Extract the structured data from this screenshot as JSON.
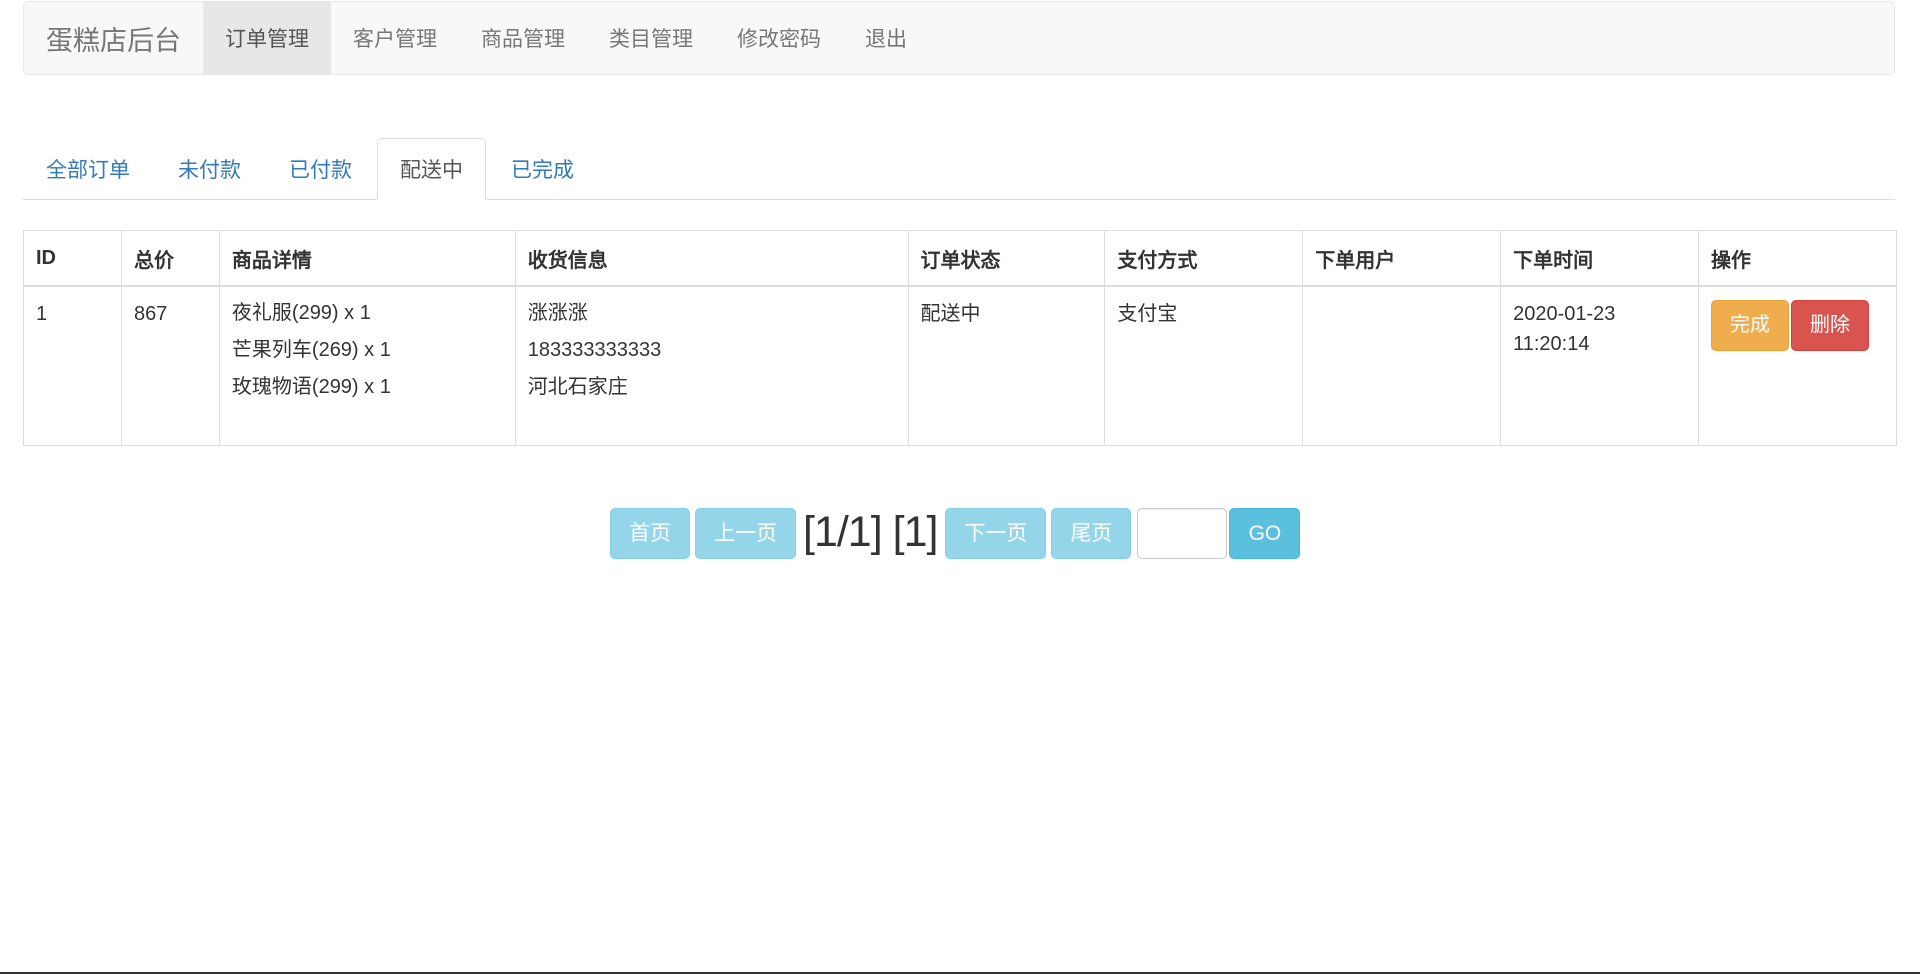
{
  "navbar": {
    "brand": "蛋糕店后台",
    "items": [
      {
        "label": "订单管理",
        "active": true
      },
      {
        "label": "客户管理",
        "active": false
      },
      {
        "label": "商品管理",
        "active": false
      },
      {
        "label": "类目管理",
        "active": false
      },
      {
        "label": "修改密码",
        "active": false
      },
      {
        "label": "退出",
        "active": false
      }
    ]
  },
  "tabs": [
    {
      "label": "全部订单",
      "active": false
    },
    {
      "label": "未付款",
      "active": false
    },
    {
      "label": "已付款",
      "active": false
    },
    {
      "label": "配送中",
      "active": true
    },
    {
      "label": "已完成",
      "active": false
    }
  ],
  "table": {
    "headers": [
      "ID",
      "总价",
      "商品详情",
      "收货信息",
      "订单状态",
      "支付方式",
      "下单用户",
      "下单时间",
      "操作"
    ],
    "rows": [
      {
        "id": "1",
        "total": "867",
        "items": [
          "夜礼服(299) x 1",
          "芒果列车(269) x 1",
          "玫瑰物语(299) x 1"
        ],
        "shipping": [
          "涨涨涨",
          "183333333333",
          "河北石家庄"
        ],
        "status": "配送中",
        "payment": "支付宝",
        "user": "",
        "time_date": "2020-01-23",
        "time_clock": "11:20:14",
        "complete_label": "完成",
        "delete_label": "删除"
      }
    ]
  },
  "pagination": {
    "first": "首页",
    "prev": "上一页",
    "info": "[1/1] [1]",
    "next": "下一页",
    "last": "尾页",
    "input_value": "",
    "go": "GO"
  },
  "colors": {
    "navbar_bg": "#f8f8f8",
    "link": "#337ab7",
    "warning": "#f0ad4e",
    "danger": "#d9534f",
    "info": "#5bc0de"
  }
}
